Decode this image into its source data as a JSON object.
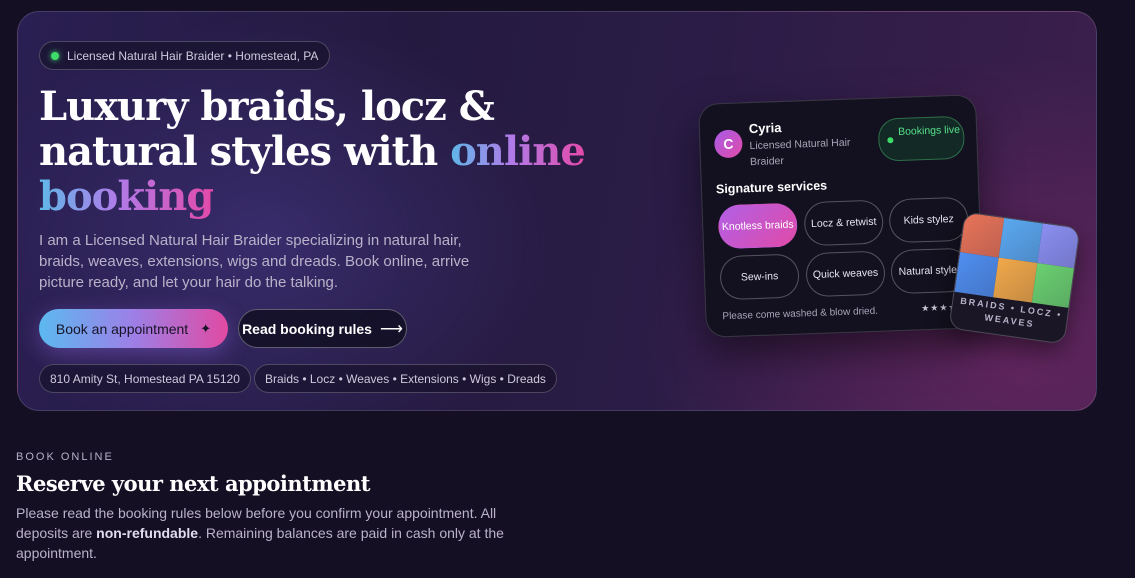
{
  "hero": {
    "badge": "Licensed Natural Hair Braider • Homestead, PA",
    "headline_line1": "Luxury braids, locz &",
    "headline_line2_plain": "natural styles with ",
    "headline_line2_grad": "online",
    "headline_line3_grad": "booking",
    "description": "I am a Licensed Natural Hair Braider specializing in natural hair, braids, weaves, extensions, wigs and dreads. Book online, arrive picture ready, and let your hair do the talking.",
    "primary_button": "Book an appointment",
    "primary_button_icon": "✦",
    "secondary_button": "Read booking rules",
    "secondary_button_icon": "⟶",
    "address": "810 Amity St, Homestead PA 15120",
    "services_tagline": "Braids • Locz • Weaves • Extensions • Wigs • Dreads"
  },
  "profile_card": {
    "avatar_letter": "C",
    "name": "Cyria",
    "role": "Licensed Natural Hair Braider",
    "status": "Bookings live",
    "services_title": "Signature services",
    "services": [
      "Knotless braids",
      "Locz & retwist",
      "Kids stylez",
      "Sew-ins",
      "Quick weaves",
      "Natural stylez"
    ],
    "selected_service": "Knotless braids",
    "note": "Please come washed & blow dried.",
    "stars": "★★★★★"
  },
  "mini_card": {
    "label": "BRAIDS • LOCZ • WEAVES",
    "mosaic_colors": [
      "#e8745a",
      "#5aa8f0",
      "#8a8ef0",
      "#4f8ef0",
      "#f0a84a",
      "#6ad070"
    ]
  },
  "section": {
    "eyebrow": "BOOK ONLINE",
    "title": "Reserve your next appointment",
    "desc_part1": "Please read the booking rules below before you confirm your appointment. All deposits are ",
    "desc_bold": "non-refundable",
    "desc_part2": ". Remaining balances are paid in cash only at the appointment."
  },
  "colors": {
    "accent_blue": "#5cb9f0",
    "accent_pink": "#e14aa2",
    "live_green": "#3ddc6a"
  }
}
